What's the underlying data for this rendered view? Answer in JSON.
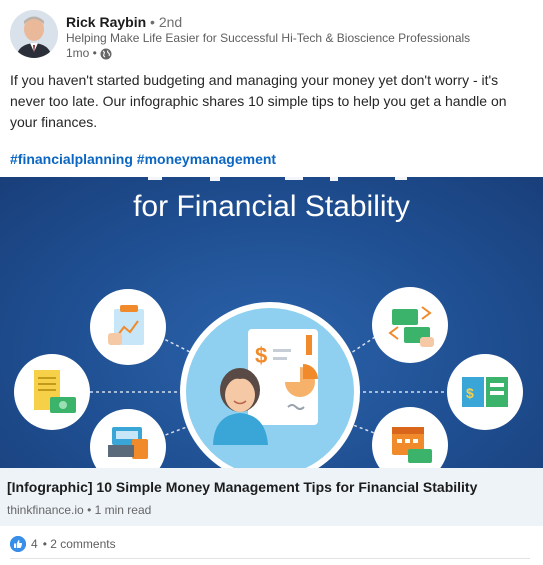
{
  "post": {
    "author": {
      "name": "Rick Raybin",
      "degree": "• 2nd",
      "headline": "Helping Make Life Easier for Successful Hi-Tech & Bioscience Professionals",
      "time": "1mo •"
    },
    "text": "If you haven't started budgeting and managing your money yet don't worry - it's never too late. Our infographic shares 10 simple tips to help you get a handle on your finances.",
    "hashtags": [
      "#financialplanning",
      "#moneymanagement"
    ]
  },
  "infographic": {
    "title": "for Financial Stability",
    "colors": {
      "background": "#1f4f92",
      "circle": "#ffffff",
      "center_circle": "#8fd0f0"
    },
    "icons": [
      "checklist-icon",
      "receipt-icon",
      "cash-register-icon",
      "document-chart-icon",
      "person-icon",
      "money-transfer-icon",
      "book-money-icon",
      "calendar-money-icon"
    ]
  },
  "link": {
    "title": "[Infographic] 10 Simple Money Management Tips for Financial Stability",
    "source": "thinkfinance.io",
    "read_time": "• 1 min read"
  },
  "social": {
    "reactions": "4",
    "comments": "• 2 comments"
  },
  "colors": {
    "accent": "#0a66c2",
    "link_bg": "#eef3f8",
    "like": "#378fe9"
  }
}
